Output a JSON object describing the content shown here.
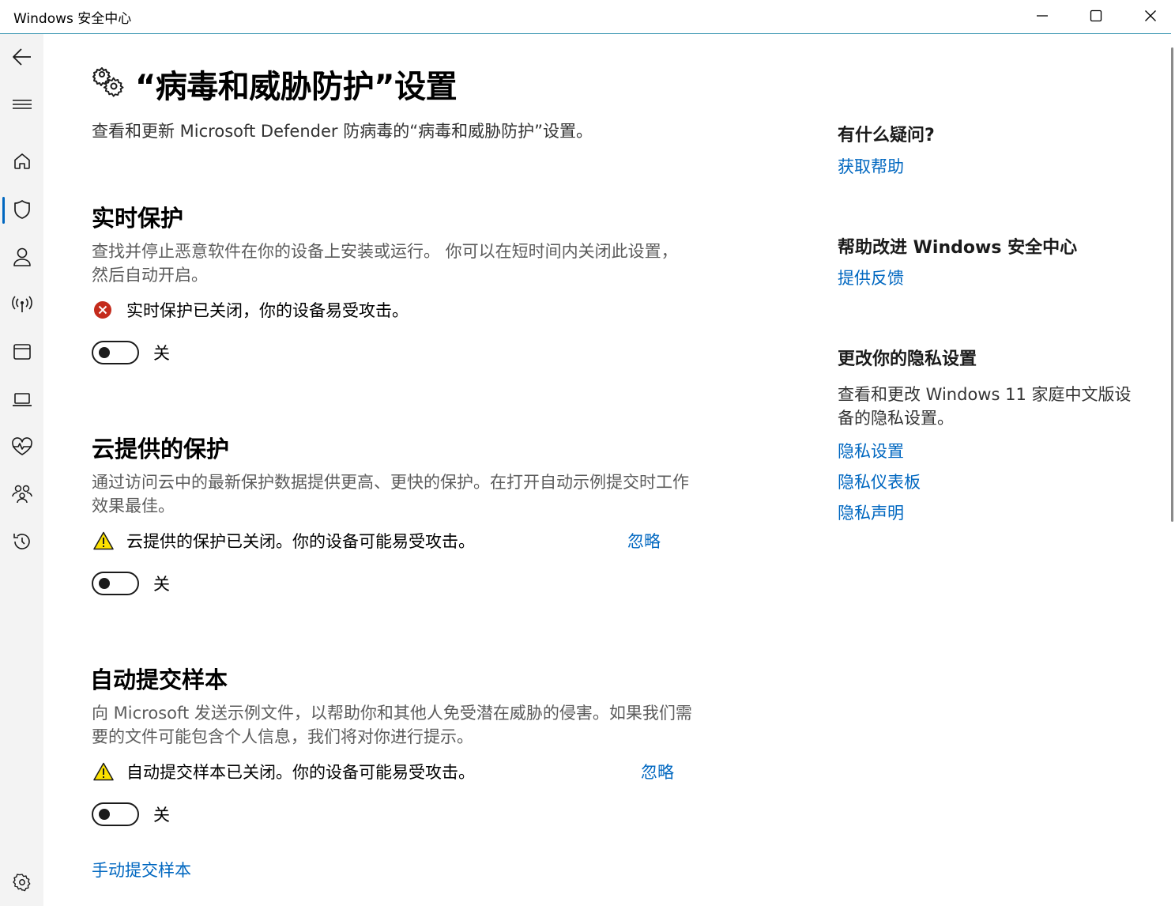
{
  "window": {
    "title": "Windows 安全中心",
    "minimize_icon": "minimize-icon",
    "maximize_icon": "maximize-icon",
    "close_icon": "close-icon"
  },
  "sidebar": {
    "items": [
      {
        "name": "back",
        "icon": "back-arrow-icon"
      },
      {
        "name": "menu",
        "icon": "hamburger-icon"
      },
      {
        "name": "home",
        "icon": "home-icon"
      },
      {
        "name": "virus-protection",
        "icon": "shield-icon",
        "active": true
      },
      {
        "name": "account-protection",
        "icon": "person-icon"
      },
      {
        "name": "firewall",
        "icon": "broadcast-icon"
      },
      {
        "name": "app-browser-control",
        "icon": "browser-window-icon"
      },
      {
        "name": "device-security",
        "icon": "laptop-icon"
      },
      {
        "name": "device-performance",
        "icon": "heart-pulse-icon"
      },
      {
        "name": "family-options",
        "icon": "family-icon"
      },
      {
        "name": "protection-history",
        "icon": "history-icon"
      },
      {
        "name": "settings",
        "icon": "gear-icon"
      }
    ],
    "accent_color": "#0067c0"
  },
  "page": {
    "title": "“病毒和威胁防护”设置",
    "title_icon": "gears-icon",
    "description": "查看和更新 Microsoft Defender 防病毒的“病毒和威胁防护”设置。"
  },
  "sections": {
    "realtime": {
      "heading": "实时保护",
      "description": "查找并停止恶意软件在你的设备上安装或运行。 你可以在短时间内关闭此设置，然后自动开启。",
      "status_icon": "error-circle-icon",
      "status_text": "实时保护已关闭，你的设备易受攻击。",
      "toggle_state": "关",
      "toggle_on": false
    },
    "cloud": {
      "heading": "云提供的保护",
      "description": "通过访问云中的最新保护数据提供更高、更快的保护。在打开自动示例提交时工作效果最佳。",
      "status_icon": "warning-triangle-icon",
      "status_text": "云提供的保护已关闭。你的设备可能易受攻击。",
      "dismiss": "忽略",
      "toggle_state": "关",
      "toggle_on": false
    },
    "samples": {
      "heading": "自动提交样本",
      "description": "向 Microsoft 发送示例文件，以帮助你和其他人免受潜在威胁的侵害。如果我们需要的文件可能包含个人信息，我们将对你进行提示。",
      "status_icon": "warning-triangle-icon",
      "status_text": "自动提交样本已关闭。你的设备可能易受攻击。",
      "dismiss": "忽略",
      "toggle_state": "关",
      "toggle_on": false,
      "manual_link": "手动提交样本"
    }
  },
  "aside": {
    "question_heading": "有什么疑问?",
    "get_help": "获取帮助",
    "improve_heading": "帮助改进 Windows 安全中心",
    "feedback": "提供反馈",
    "privacy_heading": "更改你的隐私设置",
    "privacy_text": "查看和更改 Windows 11 家庭中文版设备的隐私设置。",
    "privacy_links": [
      "隐私设置",
      "隐私仪表板",
      "隐私声明"
    ]
  },
  "colors": {
    "link": "#0067c0",
    "error": "#c42b1c",
    "warning": "#fce100"
  }
}
